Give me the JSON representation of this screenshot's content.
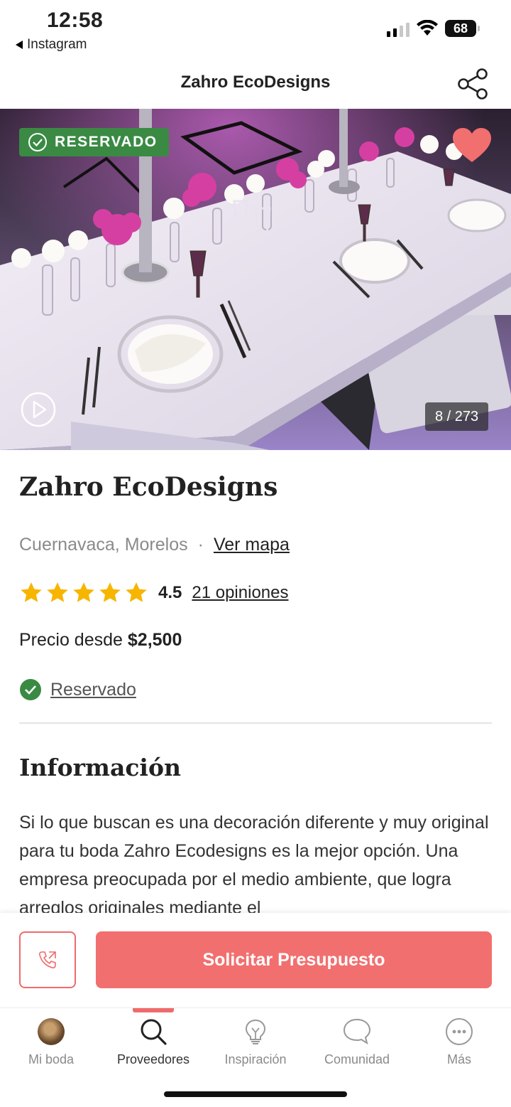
{
  "status_bar": {
    "time": "12:58",
    "back_app": "Instagram",
    "battery": "68"
  },
  "header": {
    "title": "Zahro EcoDesigns",
    "share_icon": "share-icon"
  },
  "hero": {
    "badge": "RESERVADO",
    "counter": "8 / 273",
    "favorite_color": "#f26f6f"
  },
  "vendor": {
    "name": "Zahro EcoDesigns",
    "location": "Cuernavaca, Morelos",
    "separator": "·",
    "map_link": "Ver mapa",
    "rating": "4.5",
    "stars": 5,
    "reviews": "21 opiniones",
    "price_prefix": "Precio desde",
    "price": "$2,500",
    "status": "Reservado"
  },
  "info": {
    "title": "Información",
    "text": "Si lo que buscan es una decoración diferente y muy original para tu boda Zahro Ecodesigns es la mejor opción. Una empresa preocupada por el medio ambiente, que logra arreglos originales mediante el"
  },
  "cta": {
    "quote_label": "Solicitar Presupuesto",
    "accent": "#f26f6f"
  },
  "nav": {
    "items": [
      {
        "label": "Mi boda",
        "icon": "avatar-icon"
      },
      {
        "label": "Proveedores",
        "icon": "search-icon"
      },
      {
        "label": "Inspiración",
        "icon": "lightbulb-icon"
      },
      {
        "label": "Comunidad",
        "icon": "chat-bubble-icon"
      },
      {
        "label": "Más",
        "icon": "more-icon"
      }
    ],
    "active_index": 1
  }
}
